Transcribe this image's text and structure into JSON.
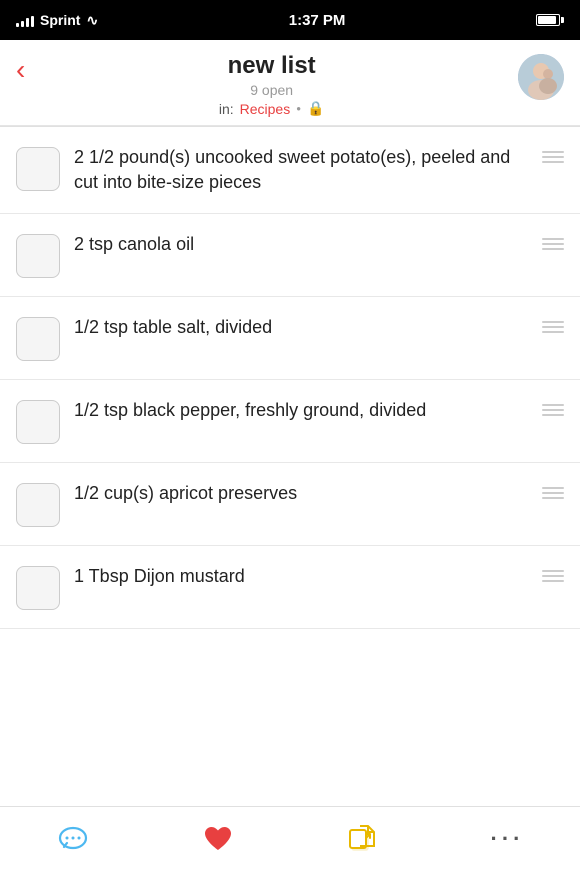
{
  "status_bar": {
    "carrier": "Sprint",
    "time": "1:37 PM",
    "signal_bars": [
      3,
      6,
      9,
      12,
      14
    ]
  },
  "header": {
    "back_label": "‹",
    "title": "new list",
    "subtitle": "9 open",
    "category_prefix": "in:",
    "category_link": "Recipes",
    "avatar_initials": "👤"
  },
  "list_items": [
    {
      "id": 1,
      "text": "2 1/2 pound(s) uncooked sweet potato(es), peeled and cut into bite-size pieces"
    },
    {
      "id": 2,
      "text": "2 tsp canola oil"
    },
    {
      "id": 3,
      "text": "1/2 tsp table salt, divided"
    },
    {
      "id": 4,
      "text": "1/2 tsp black pepper, freshly ground, divided"
    },
    {
      "id": 5,
      "text": "1/2 cup(s) apricot preserves"
    },
    {
      "id": 6,
      "text": "1 Tbsp Dijon mustard"
    }
  ],
  "tab_bar": {
    "chat_label": "💬",
    "heart_label": "♥",
    "share_label": "↗",
    "more_label": "•••"
  }
}
